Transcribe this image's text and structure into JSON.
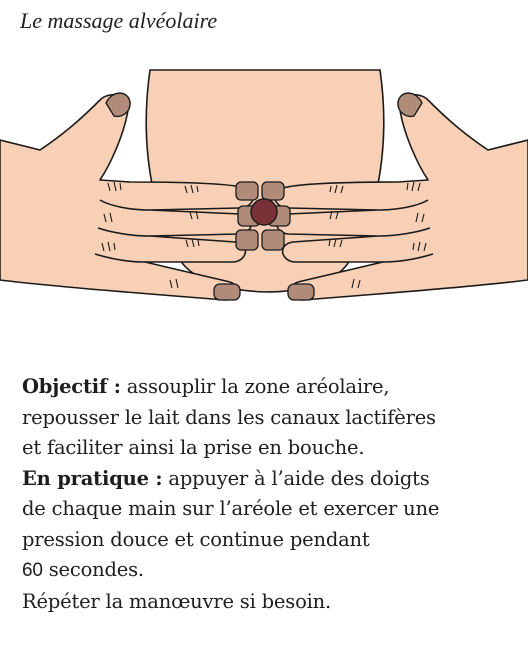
{
  "title": "Le massage alvéolaire",
  "section1": {
    "label": "Objectif :",
    "lines": [
      " assouplir la zone aréolaire,",
      "repousser le lait dans les canaux lactifères",
      "et faciliter ainsi la prise en bouche."
    ]
  },
  "section2": {
    "label": "En pratique :",
    "lines": [
      " appuyer à l’aide des doigts",
      "de chaque main sur l’aréole et exercer une",
      "pression douce et continue pendant"
    ],
    "duration_value": "60",
    "duration_unit": " secondes."
  },
  "closing": "Répéter la manœuvre si besoin.",
  "colors": {
    "skin": "#f7d0b6",
    "skin_dark": "#f5c4a8",
    "nail": "#b08b7a",
    "areola": "#7a3238",
    "outline": "#1a1a1a"
  }
}
